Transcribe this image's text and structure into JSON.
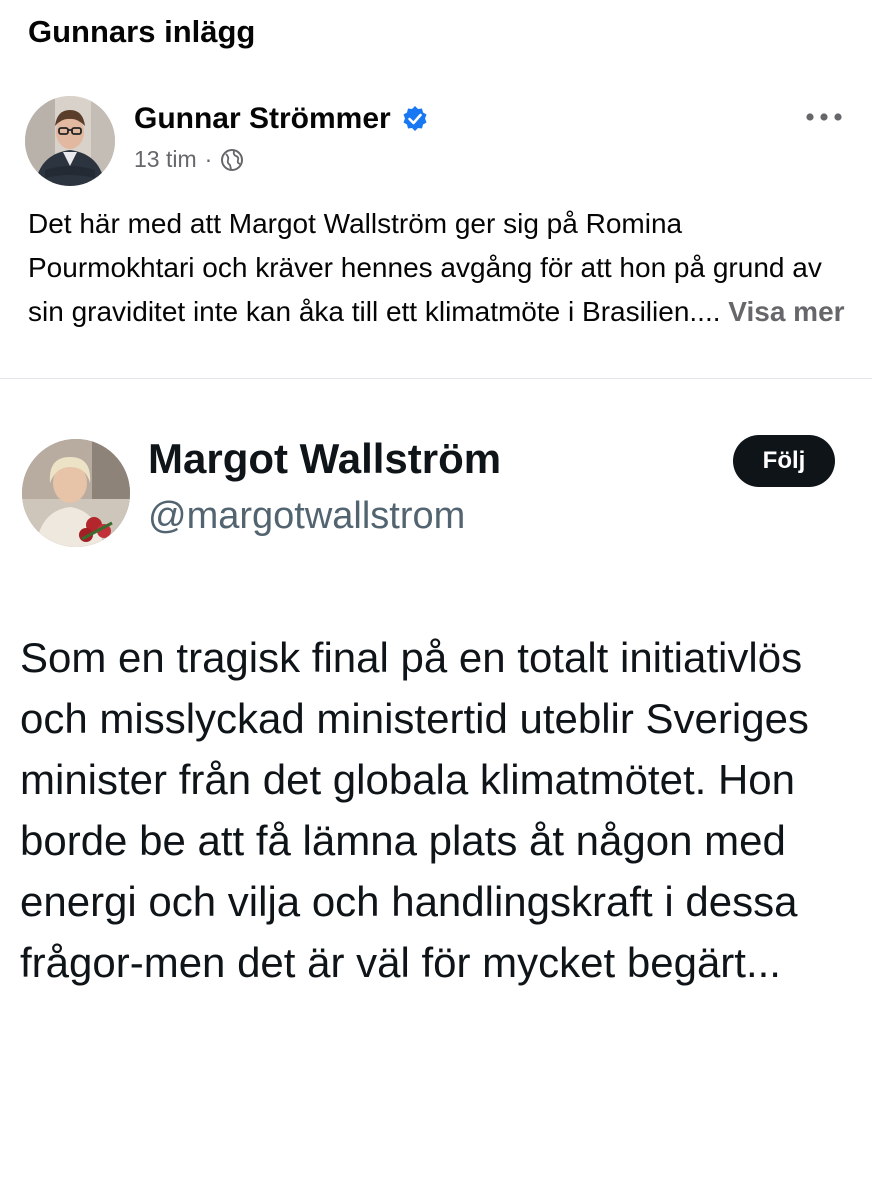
{
  "page": {
    "title": "Gunnars inlägg"
  },
  "post": {
    "author": "Gunnar Strömmer",
    "time": "13 tim",
    "separator": "·",
    "text": "Det här med att Margot Wallström ger sig på Romina Pourmokhtari och kräver hennes avgång för att hon på grund av sin graviditet inte kan åka till ett klimatmöte i Brasilien....",
    "see_more": "Visa mer",
    "icons": {
      "verified": "verified-badge-icon",
      "audience": "globe-icon",
      "menu": "more-options-icon"
    },
    "colors": {
      "verified": "#1877f2",
      "meta": "#65676b"
    }
  },
  "tweet": {
    "name": "Margot Wallström",
    "handle": "@margotwallstrom",
    "follow_label": "Följ",
    "text": "Som en tragisk final på en totalt initiativlös och misslyckad ministertid uteblir Sveriges minister från det globala klimatmötet. Hon borde be att få lämna plats åt någon med energi och vilja och handlingskraft i dessa frågor-men det är väl för mycket begärt..."
  }
}
